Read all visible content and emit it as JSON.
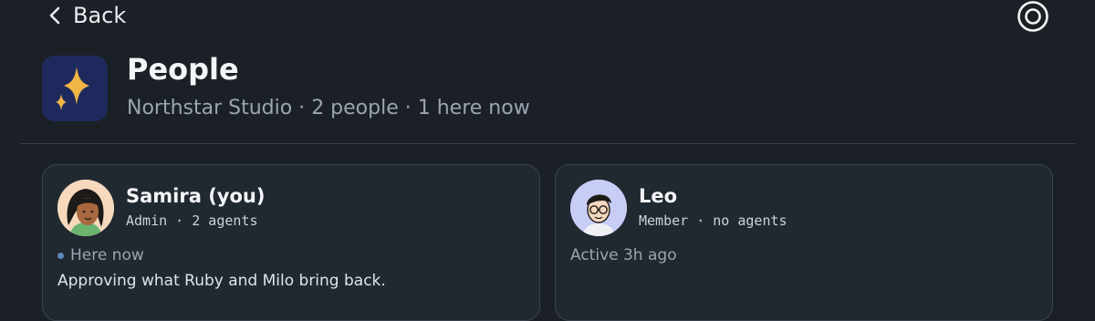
{
  "nav": {
    "back_label": "Back",
    "back_icon": "chevron-left-icon",
    "menu_icon": "circle-menu-icon"
  },
  "header": {
    "title": "People",
    "subtitle": "Northstar Studio · 2 people · 1 here now",
    "logo_icon": "sparkles-icon"
  },
  "colors": {
    "background": "#1b2026",
    "card": "#212930",
    "accent_star": "#f0b545",
    "presence_dot": "#5e87bd"
  },
  "people": [
    {
      "name": "Samira (you)",
      "meta": "Admin · 2 agents",
      "presence": "Here now",
      "online": true,
      "note": "Approving what Ruby and Milo bring back."
    },
    {
      "name": "Leo",
      "meta": "Member · no agents",
      "presence": "Active 3h ago",
      "online": false
    }
  ]
}
